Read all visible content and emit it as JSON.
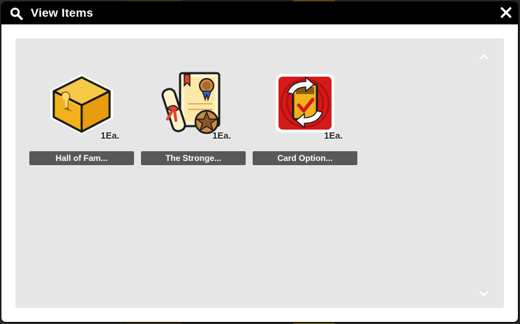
{
  "window": {
    "title": "View Items",
    "icons": {
      "title": "search-icon",
      "close": "close-icon"
    }
  },
  "scroll": {
    "up_icon": "chevron-up-icon",
    "down_icon": "chevron-down-icon"
  },
  "items": [
    {
      "name": "Hall of Fam...",
      "quantity": "1Ea.",
      "icon": "hall-of-fame-trophy-box-icon"
    },
    {
      "name": "The Stronge...",
      "quantity": "1Ea.",
      "icon": "certificate-scroll-icon"
    },
    {
      "name": "Card Option...",
      "quantity": "1Ea.",
      "icon": "card-option-change-icon"
    }
  ],
  "colors": {
    "titlebar": "#000000",
    "panel": "#e6e6e6",
    "name_plate": "#585858",
    "accent_gold": "#f2b21b",
    "accent_red": "#d41a1a"
  }
}
